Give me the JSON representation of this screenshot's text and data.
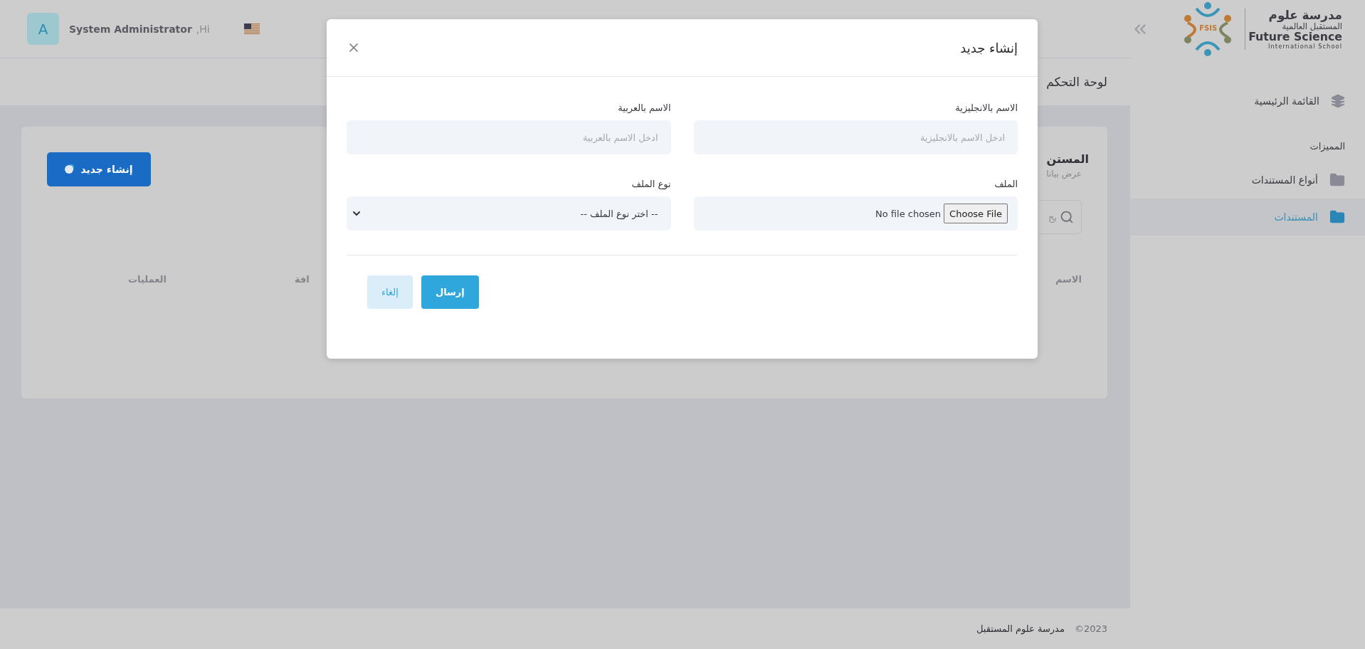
{
  "header": {
    "avatar": "A",
    "user_name": "System Administrator",
    "greeting": ",Hi"
  },
  "breadcrumb": "لوحة التحكم",
  "sidebar": {
    "logo": {
      "arabic_name": "مدرسة علوم",
      "arabic_subtitle": "المستقبل العالمية",
      "english_name": "Future Science",
      "english_subtitle": "International School",
      "badge": "FSIS"
    },
    "menu": [
      {
        "label": "القائمة الرئيسية",
        "selected": false
      }
    ],
    "section": {
      "title": "المميزات",
      "items": [
        {
          "label": "أنواع المستندات",
          "selected": false
        },
        {
          "label": "المستندات",
          "selected": true
        }
      ]
    }
  },
  "card": {
    "title": "المستن",
    "subtitle": "عرض بيانا",
    "search_placeholder": "بح",
    "create_button": "إنشاء جديد",
    "columns": [
      "الاسم",
      "افة",
      "العمليات"
    ]
  },
  "modal": {
    "title": "إنشاء جديد",
    "fields": [
      {
        "label": "الاسم بالانجليزية",
        "kind": "text",
        "placeholder": "ادخل الاسم بالانجليزية"
      },
      {
        "label": "الاسم بالعربية",
        "kind": "text",
        "placeholder": "ادخل الاسم بالعربية"
      },
      {
        "label": "الملف",
        "kind": "file",
        "button": "Choose File",
        "status": "No file chosen"
      },
      {
        "label": "نوع الملف",
        "kind": "select",
        "value": "-- اختر نوع الملف --"
      }
    ],
    "buttons": [
      {
        "label": "إرسال",
        "kind": "primary"
      },
      {
        "label": "إلغاء",
        "kind": "secondary"
      }
    ]
  },
  "footer": {
    "copyright": "©2023",
    "name": "مدرسة علوم المستقبل"
  }
}
